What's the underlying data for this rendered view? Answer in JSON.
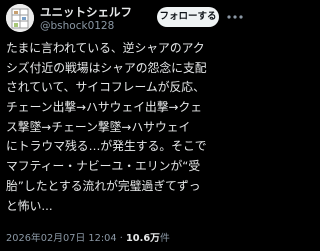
{
  "author": {
    "display_name": "ユニットシェルフ",
    "handle": "@bshock0128",
    "avatar_icon": "shelf-unit-avatar-icon"
  },
  "follow_button": {
    "label": "フォローする"
  },
  "more_menu": {
    "icon": "more-dots-icon"
  },
  "tweet": {
    "lines": [
      "たまに言われている、逆シャアのアク",
      "シズ付近の戦場はシャアの怨念に支配",
      "されていて、サイコフレームが反応、",
      "チェーン出撃→ハサウェイ出撃→クェ",
      "ス撃墜→チェーン撃墜→ハサウェイ",
      "にトラウマ残る…が発生する。そこで",
      "マフティー・ナビーユ・エリンが“受",
      "胎”したとする流れが完璧過ぎてずっ",
      "と怖い..."
    ]
  },
  "meta": {
    "timestamp": "2026年02月07日 12:04",
    "separator": "·",
    "views_count": "10.6万",
    "views_label": "件"
  },
  "colors": {
    "background": "#000000",
    "primary_text": "#e7e9ea",
    "secondary_text": "#8b98a5",
    "follow_button_bg": "#eff3f4",
    "follow_button_text": "#0f1419"
  }
}
